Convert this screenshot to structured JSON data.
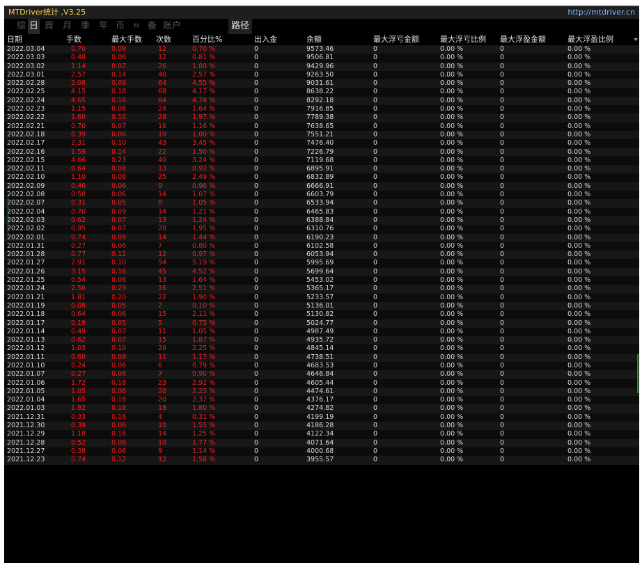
{
  "window": {
    "title": "MTDriver统计 ,V3.25",
    "url": "http://mtdriver.cn"
  },
  "tabs": [
    {
      "label": "综",
      "active": false
    },
    {
      "label": "日",
      "active": true
    },
    {
      "label": "周",
      "active": false
    },
    {
      "label": "月",
      "active": false
    },
    {
      "label": "季",
      "active": false
    },
    {
      "label": "年",
      "active": false
    },
    {
      "label": "币",
      "active": false
    },
    {
      "label": "M",
      "active": false
    },
    {
      "label": "备",
      "active": false
    },
    {
      "label": "账户",
      "active": false
    }
  ],
  "path_button": "路径",
  "columns": [
    "日期",
    "手数",
    "最大手数",
    "次数",
    "百分比%",
    "出入金",
    "余额",
    "最大浮亏金额",
    "最大浮亏比例",
    "最大浮盈金额",
    "最大浮盈比例"
  ],
  "colors": {
    "accent_red": "#ff1a1a",
    "title_yellow": "#ffd24a",
    "link_blue": "#7db7ff"
  },
  "rows": [
    [
      "2022.03.04",
      "0.70",
      "0.09",
      "12",
      "0.70 %",
      "0",
      "9573.46",
      "0",
      "0.00 %",
      "0",
      "0.00 %"
    ],
    [
      "2022.03.03",
      "0.48",
      "0.06",
      "12",
      "0.81 %",
      "0",
      "9506.81",
      "0",
      "0.00 %",
      "0",
      "0.00 %"
    ],
    [
      "2022.03.02",
      "1.14",
      "0.07",
      "26",
      "1.80 %",
      "0",
      "9429.96",
      "0",
      "0.00 %",
      "0",
      "0.00 %"
    ],
    [
      "2022.03.01",
      "2.57",
      "0.14",
      "40",
      "2.57 %",
      "0",
      "9263.50",
      "0",
      "0.00 %",
      "0",
      "0.00 %"
    ],
    [
      "2022.02.28",
      "2.08",
      "0.09",
      "64",
      "4.55 %",
      "0",
      "9031.61",
      "0",
      "0.00 %",
      "0",
      "0.00 %"
    ],
    [
      "2022.02.25",
      "4.15",
      "0.18",
      "68",
      "4.17 %",
      "0",
      "8638.22",
      "0",
      "0.00 %",
      "0",
      "0.00 %"
    ],
    [
      "2022.02.24",
      "4.65",
      "0.18",
      "64",
      "4.74 %",
      "0",
      "8292.18",
      "0",
      "0.00 %",
      "0",
      "0.00 %"
    ],
    [
      "2022.02.23",
      "1.15",
      "0.08",
      "24",
      "1.64 %",
      "0",
      "7916.85",
      "0",
      "0.00 %",
      "0",
      "0.00 %"
    ],
    [
      "2022.02.22",
      "1.60",
      "0.10",
      "28",
      "1.97 %",
      "0",
      "7789.38",
      "0",
      "0.00 %",
      "0",
      "0.00 %"
    ],
    [
      "2022.02.21",
      "0.70",
      "0.07",
      "16",
      "1.16 %",
      "0",
      "7638.65",
      "0",
      "0.00 %",
      "0",
      "0.00 %"
    ],
    [
      "2022.02.18",
      "0.39",
      "0.06",
      "10",
      "1.00 %",
      "0",
      "7551.21",
      "0",
      "0.00 %",
      "0",
      "0.00 %"
    ],
    [
      "2022.02.17",
      "2.31",
      "0.10",
      "43",
      "3.45 %",
      "0",
      "7476.40",
      "0",
      "0.00 %",
      "0",
      "0.00 %"
    ],
    [
      "2022.02.16",
      "1.59",
      "0.14",
      "22",
      "1.50 %",
      "0",
      "7226.79",
      "0",
      "0.00 %",
      "0",
      "0.00 %"
    ],
    [
      "2022.02.15",
      "4.66",
      "0.23",
      "40",
      "3.24 %",
      "0",
      "7119.68",
      "0",
      "0.00 %",
      "0",
      "0.00 %"
    ],
    [
      "2022.02.11",
      "0.64",
      "0.08",
      "13",
      "0.92 %",
      "0",
      "6895.91",
      "0",
      "0.00 %",
      "0",
      "0.00 %"
    ],
    [
      "2022.02.10",
      "1.10",
      "0.08",
      "25",
      "2.49 %",
      "0",
      "6832.89",
      "0",
      "0.00 %",
      "0",
      "0.00 %"
    ],
    [
      "2022.02.09",
      "0.40",
      "0.06",
      "9",
      "0.96 %",
      "0",
      "6666.91",
      "0",
      "0.00 %",
      "0",
      "0.00 %"
    ],
    [
      "2022.02.08",
      "0.58",
      "0.06",
      "14",
      "1.07 %",
      "0",
      "6603.79",
      "0",
      "0.00 %",
      "0",
      "0.00 %"
    ],
    [
      "2022.02.07",
      "0.31",
      "0.05",
      "8",
      "1.05 %",
      "0",
      "6533.94",
      "0",
      "0.00 %",
      "0",
      "0.00 %"
    ],
    [
      "2022.02.04",
      "0.70",
      "0.09",
      "14",
      "1.21 %",
      "0",
      "6465.83",
      "0",
      "0.00 %",
      "0",
      "0.00 %"
    ],
    [
      "2022.02.03",
      "0.62",
      "0.07",
      "13",
      "1.24 %",
      "0",
      "6388.84",
      "0",
      "0.00 %",
      "0",
      "0.00 %"
    ],
    [
      "2022.02.02",
      "0.95",
      "0.07",
      "20",
      "1.95 %",
      "0",
      "6310.76",
      "0",
      "0.00 %",
      "0",
      "0.00 %"
    ],
    [
      "2022.02.01",
      "0.74",
      "0.09",
      "14",
      "1.44 %",
      "0",
      "6190.23",
      "0",
      "0.00 %",
      "0",
      "0.00 %"
    ],
    [
      "2022.01.31",
      "0.27",
      "0.06",
      "7",
      "0.80 %",
      "0",
      "6102.58",
      "0",
      "0.00 %",
      "0",
      "0.00 %"
    ],
    [
      "2022.01.28",
      "0.77",
      "0.12",
      "12",
      "0.97 %",
      "0",
      "6053.94",
      "0",
      "0.00 %",
      "0",
      "0.00 %"
    ],
    [
      "2022.01.27",
      "2.91",
      "0.10",
      "54",
      "5.19 %",
      "0",
      "5995.69",
      "0",
      "0.00 %",
      "0",
      "0.00 %"
    ],
    [
      "2022.01.26",
      "3.15",
      "0.16",
      "45",
      "4.52 %",
      "0",
      "5699.64",
      "0",
      "0.00 %",
      "0",
      "0.00 %"
    ],
    [
      "2022.01.25",
      "0.54",
      "0.06",
      "13",
      "1.64 %",
      "0",
      "5453.02",
      "0",
      "0.00 %",
      "0",
      "0.00 %"
    ],
    [
      "2022.01.24",
      "2.56",
      "0.29",
      "16",
      "2.51 %",
      "0",
      "5365.17",
      "0",
      "0.00 %",
      "0",
      "0.00 %"
    ],
    [
      "2022.01.21",
      "1.81",
      "0.20",
      "22",
      "1.90 %",
      "0",
      "5233.57",
      "0",
      "0.00 %",
      "0",
      "0.00 %"
    ],
    [
      "2022.01.19",
      "0.08",
      "0.05",
      "2",
      "0.10 %",
      "0",
      "5136.01",
      "0",
      "0.00 %",
      "0",
      "0.00 %"
    ],
    [
      "2022.01.18",
      "0.64",
      "0.06",
      "15",
      "2.11 %",
      "0",
      "5130.82",
      "0",
      "0.00 %",
      "0",
      "0.00 %"
    ],
    [
      "2022.01.17",
      "0.19",
      "0.05",
      "5",
      "0.75 %",
      "0",
      "5024.77",
      "0",
      "0.00 %",
      "0",
      "0.00 %"
    ],
    [
      "2022.01.14",
      "0.49",
      "0.07",
      "11",
      "1.05 %",
      "0",
      "4987.49",
      "0",
      "0.00 %",
      "0",
      "0.00 %"
    ],
    [
      "2022.01.13",
      "0.62",
      "0.07",
      "15",
      "1.87 %",
      "0",
      "4935.72",
      "0",
      "0.00 %",
      "0",
      "0.00 %"
    ],
    [
      "2022.01.12",
      "1.03",
      "0.10",
      "20",
      "2.25 %",
      "0",
      "4845.14",
      "0",
      "0.00 %",
      "0",
      "0.00 %"
    ],
    [
      "2022.01.11",
      "0.60",
      "0.09",
      "11",
      "1.17 %",
      "0",
      "4738.51",
      "0",
      "0.00 %",
      "0",
      "0.00 %"
    ],
    [
      "2022.01.10",
      "0.24",
      "0.06",
      "6",
      "0.79 %",
      "0",
      "4683.53",
      "0",
      "0.00 %",
      "0",
      "0.00 %"
    ],
    [
      "2022.01.07",
      "0.27",
      "0.06",
      "7",
      "0.90 %",
      "0",
      "4646.84",
      "0",
      "0.00 %",
      "0",
      "0.00 %"
    ],
    [
      "2022.01.06",
      "1.72",
      "0.18",
      "23",
      "2.92 %",
      "0",
      "4605.44",
      "0",
      "0.00 %",
      "0",
      "0.00 %"
    ],
    [
      "2022.01.05",
      "1.05",
      "0.08",
      "20",
      "2.25 %",
      "0",
      "4474.61",
      "0",
      "0.00 %",
      "0",
      "0.00 %"
    ],
    [
      "2022.01.04",
      "1.65",
      "0.18",
      "20",
      "2.37 %",
      "0",
      "4376.17",
      "0",
      "0.00 %",
      "0",
      "0.00 %"
    ],
    [
      "2022.01.03",
      "1.82",
      "0.18",
      "18",
      "1.80 %",
      "0",
      "4274.82",
      "0",
      "0.00 %",
      "0",
      "0.00 %"
    ],
    [
      "2021.12.31",
      "0.33",
      "0.16",
      "4",
      "0.31 %",
      "0",
      "4199.19",
      "0",
      "0.00 %",
      "0",
      "0.00 %"
    ],
    [
      "2021.12.30",
      "0.39",
      "0.06",
      "10",
      "1.55 %",
      "0",
      "4186.28",
      "0",
      "0.00 %",
      "0",
      "0.00 %"
    ],
    [
      "2021.12.29",
      "1.18",
      "0.16",
      "14",
      "1.25 %",
      "0",
      "4122.34",
      "0",
      "0.00 %",
      "0",
      "0.00 %"
    ],
    [
      "2021.12.28",
      "0.52",
      "0.08",
      "10",
      "1.77 %",
      "0",
      "4071.64",
      "0",
      "0.00 %",
      "0",
      "0.00 %"
    ],
    [
      "2021.12.27",
      "0.38",
      "0.06",
      "9",
      "1.14 %",
      "0",
      "4000.68",
      "0",
      "0.00 %",
      "0",
      "0.00 %"
    ],
    [
      "2021.12.23",
      "0.74",
      "0.12",
      "12",
      "1.58 %",
      "0",
      "3955.57",
      "0",
      "0.00 %",
      "0",
      "0.00 %"
    ]
  ]
}
